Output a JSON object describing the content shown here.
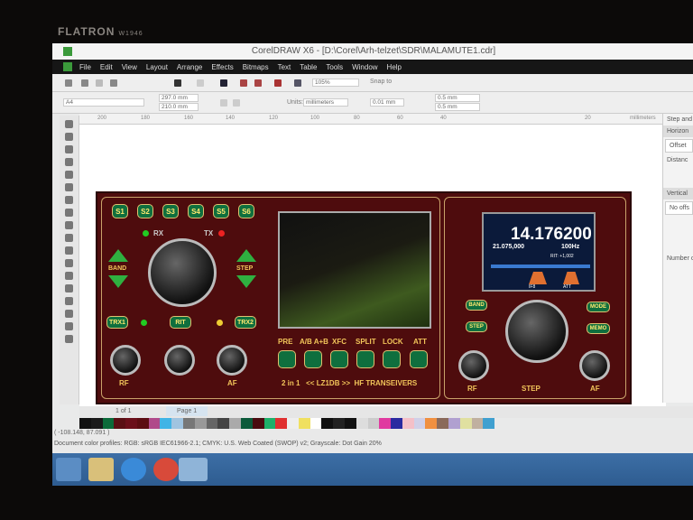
{
  "monitor": {
    "brand": "FLATRON",
    "model": "W1946"
  },
  "window": {
    "title": "CorelDRAW X6 - [D:\\Corel\\Arh-telzet\\SDR\\MALAMUTE1.cdr]"
  },
  "menu": [
    "File",
    "Edit",
    "View",
    "Layout",
    "Arrange",
    "Effects",
    "Bitmaps",
    "Text",
    "Table",
    "Tools",
    "Window",
    "Help"
  ],
  "toolbar": {
    "zoom": "105%",
    "snap_to": "Snap to"
  },
  "property_bar": {
    "page_size": "A4",
    "width": "297.0 mm",
    "height": "210.0 mm",
    "units_label": "Units:",
    "units": "millimeters",
    "nudge": "0.01 mm",
    "dup_x": "0.5 mm",
    "dup_y": "0.5 mm"
  },
  "ruler": {
    "ticks": [
      "200",
      "180",
      "160",
      "140",
      "120",
      "100",
      "80",
      "60",
      "40",
      "20"
    ],
    "unit": "millimeters"
  },
  "docker": {
    "title": "Step and",
    "horizontal": "Horizon",
    "offset": "Offset",
    "distance": "Distanc",
    "vertical": "Vertical",
    "no_offset": "No offs",
    "number": "Number o"
  },
  "radio": {
    "s_buttons": [
      "S1",
      "S2",
      "S3",
      "S4",
      "S5",
      "S6"
    ],
    "rx": "RX",
    "tx": "TX",
    "band": "BAND",
    "step": "STEP",
    "trx1": "TRX1",
    "rit": "RIT",
    "trx2": "TRX2",
    "rf": "RF",
    "af": "AF",
    "func_buttons": [
      "PRE",
      "A/B A+B",
      "XFC",
      "SPLIT",
      "LOCK",
      "ATT"
    ],
    "footer": "2 in 1   << LZ1DB >>  HF TRANSEIVERS",
    "right_band": "BAND",
    "right_step": "STEP",
    "mode": "MODE",
    "memo": "MEMO",
    "right_rf": "RF",
    "right_af": "AF",
    "step_label": "STEP",
    "lcd": {
      "freq": "14.176200",
      "sub_freq": "21.075,000",
      "step": "100Hz",
      "rit": "RIT: +1,002",
      "if": "IF8",
      "att": "ATT"
    }
  },
  "page_nav": {
    "counter": "1 of 1",
    "tab": "Page 1"
  },
  "status": {
    "coords": "( -108.148, 87.091 )",
    "profiles": "Document color profiles: RGB: sRGB IEC61966-2.1; CMYK: U.S. Web Coated (SWOP) v2; Grayscale: Dot Gain 20%"
  },
  "palette": [
    "#111111",
    "#1a1a1a",
    "#0c6b3a",
    "#5a0f14",
    "#6b0f1a",
    "#5c0d12",
    "#b04a8a",
    "#40b4e6",
    "#a0c4e0",
    "#777777",
    "#999999",
    "#666666",
    "#444444",
    "#aaaaaa",
    "#0c5a3a",
    "#4a0c10",
    "#1eb06a",
    "#e03030",
    "#eeeeee",
    "#f0e060",
    "#ffffff",
    "#111111",
    "#222222",
    "#111111",
    "#dddddd",
    "#cccccc",
    "#e03aa0",
    "#2a2aa0",
    "#f4c0c8",
    "#d0d0e8",
    "#f09040",
    "#8a6a5a",
    "#b0a0d0",
    "#e0e0a0",
    "#c0b0a0",
    "#40a0d0"
  ]
}
